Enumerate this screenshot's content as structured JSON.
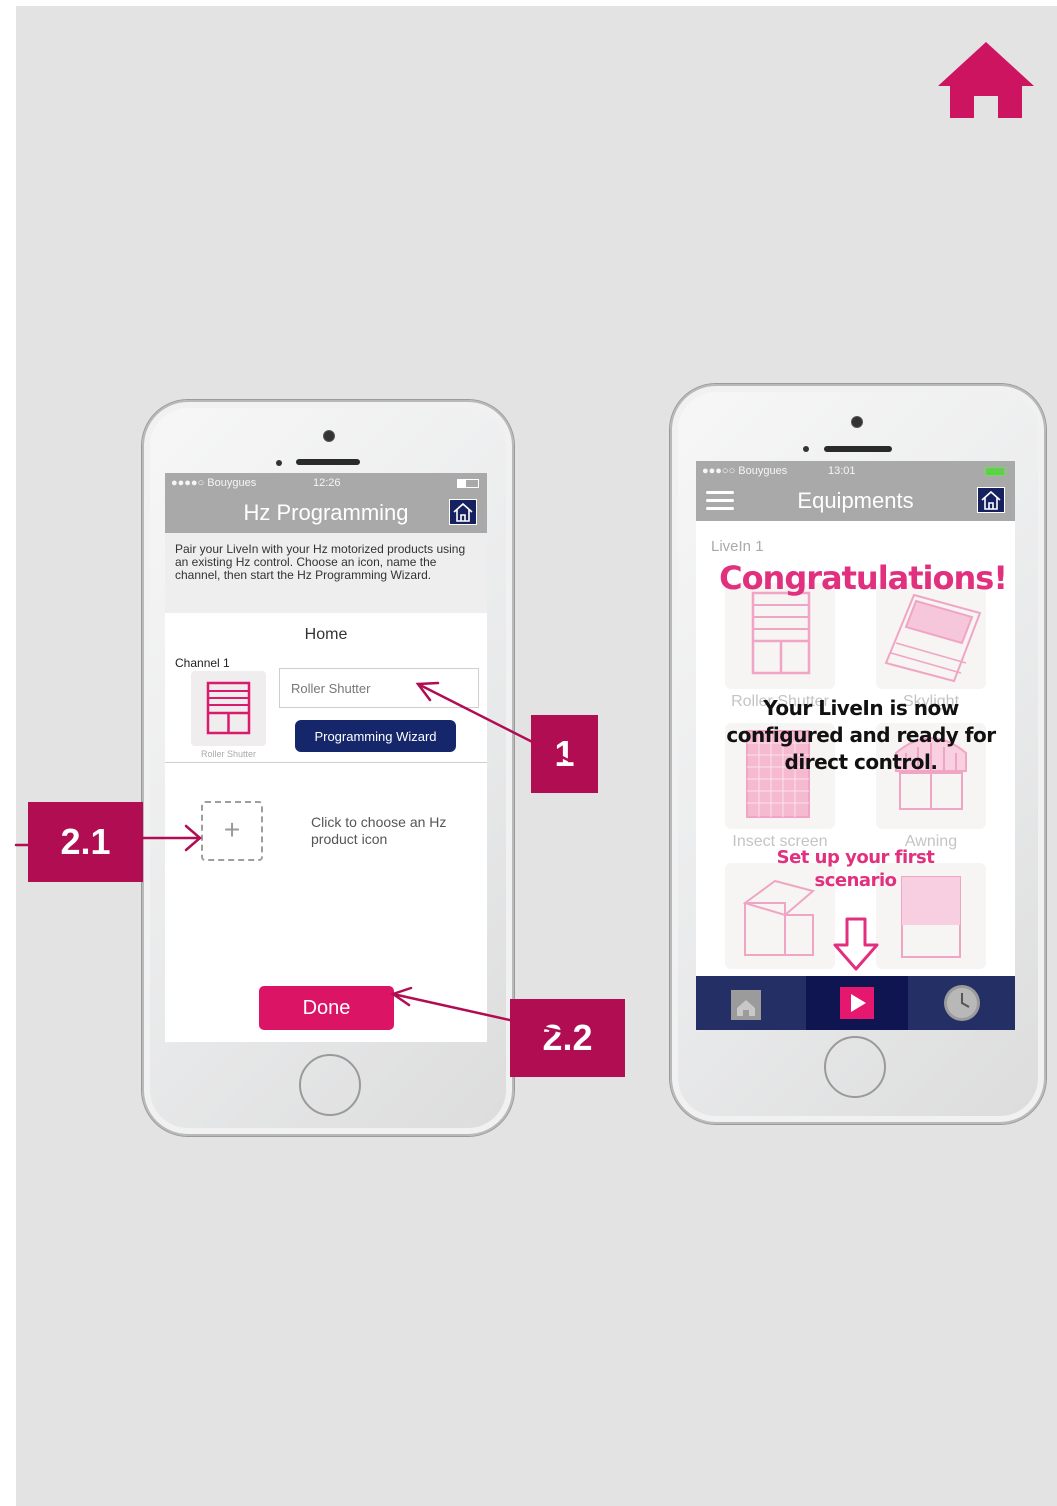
{
  "left_phone": {
    "status": {
      "carrier": "●●●●○ Bouygues",
      "time": "12:26"
    },
    "title": "Hz Programming",
    "intro": "Pair your LiveIn with your Hz motorized products using an existing Hz control. Choose an icon, name the channel, then start the Hz Programming Wizard.",
    "section_title": "Home",
    "channel_label": "Channel 1",
    "icon_label": "Roller Shutter",
    "name_input": {
      "value": "Roller Shutter"
    },
    "wizard_button": "Programming Wizard",
    "choose_text": "Click to choose an Hz product icon",
    "done_button": "Done"
  },
  "right_phone": {
    "status": {
      "carrier": "●●●○○ Bouygues",
      "time": "13:01"
    },
    "title": "Equipments",
    "group": "LiveIn 1",
    "tiles": [
      "Roller Shutter",
      "Skylight",
      "Insect screen",
      "Awning"
    ],
    "overlay": {
      "congrats": "Congratulations!",
      "configured": "Your LiveIn is now configured and ready for direct control.",
      "setup": "Set up your first scenario"
    }
  },
  "callouts": {
    "one": "1",
    "two_one": "2.1",
    "two_two": "2.2"
  },
  "colors": {
    "accent": "#db1466",
    "callout": "#b00d52",
    "navy": "#16266b",
    "panel": "#e3e3e3"
  }
}
